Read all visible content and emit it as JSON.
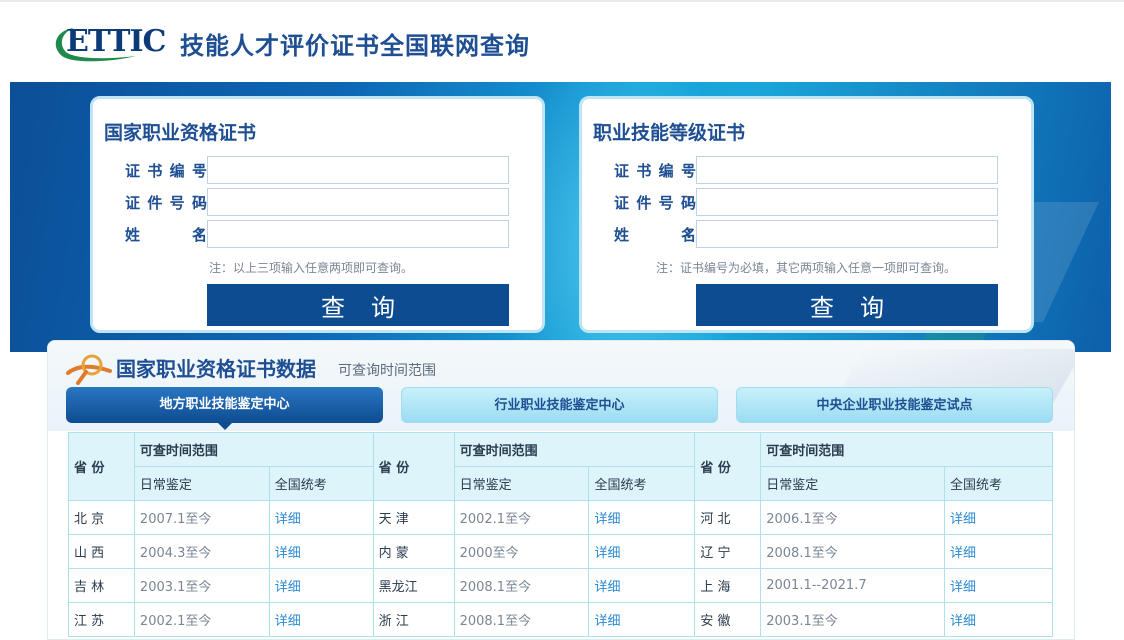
{
  "header": {
    "logo_text": "ETTIC",
    "title": "技能人才评价证书全国联网查询"
  },
  "panels": [
    {
      "title": "国家职业资格证书",
      "fields": [
        {
          "label": "证书编号",
          "value": ""
        },
        {
          "label": "证件号码",
          "value": ""
        },
        {
          "label": "姓名",
          "value": ""
        }
      ],
      "note": "注：以上三项输入任意两项即可查询。",
      "button": "查询"
    },
    {
      "title": "职业技能等级证书",
      "fields": [
        {
          "label": "证书编号",
          "value": ""
        },
        {
          "label": "证件号码",
          "value": ""
        },
        {
          "label": "姓名",
          "value": ""
        }
      ],
      "note": "注：证书编号为必填，其它两项输入任意一项即可查询。",
      "button": "查询"
    }
  ],
  "data_section": {
    "title": "国家职业资格证书数据",
    "subtitle": "可查询时间范围",
    "tabs": [
      "地方职业技能鉴定中心",
      "行业职业技能鉴定中心",
      "中央企业职业技能鉴定试点"
    ],
    "active_tab": 0,
    "table": {
      "province_header": "省 份",
      "range_header": "可查时间范围",
      "daily_header": "日常鉴定",
      "national_header": "全国统考",
      "rows": [
        [
          {
            "province": "北 京",
            "period": "2007.1至今",
            "detail": "详细"
          },
          {
            "province": "天 津",
            "period": "2002.1至今",
            "detail": "详细"
          },
          {
            "province": "河 北",
            "period": "2006.1至今",
            "detail": "详细"
          }
        ],
        [
          {
            "province": "山 西",
            "period": "2004.3至今",
            "detail": "详细"
          },
          {
            "province": "内 蒙",
            "period": "2000至今",
            "detail": "详细"
          },
          {
            "province": "辽 宁",
            "period": "2008.1至今",
            "detail": "详细"
          }
        ],
        [
          {
            "province": "吉 林",
            "period": "2003.1至今",
            "detail": "详细"
          },
          {
            "province": "黑龙江",
            "period": "2008.1至今",
            "detail": "详细"
          },
          {
            "province": "上 海",
            "period": "2001.1--2021.7",
            "detail": "详细"
          }
        ],
        [
          {
            "province": "江 苏",
            "period": "2002.1至今",
            "detail": "详细"
          },
          {
            "province": "浙 江",
            "period": "2008.1至今",
            "detail": "详细"
          },
          {
            "province": "安 徽",
            "period": "2003.1至今",
            "detail": "详细"
          }
        ]
      ]
    }
  }
}
